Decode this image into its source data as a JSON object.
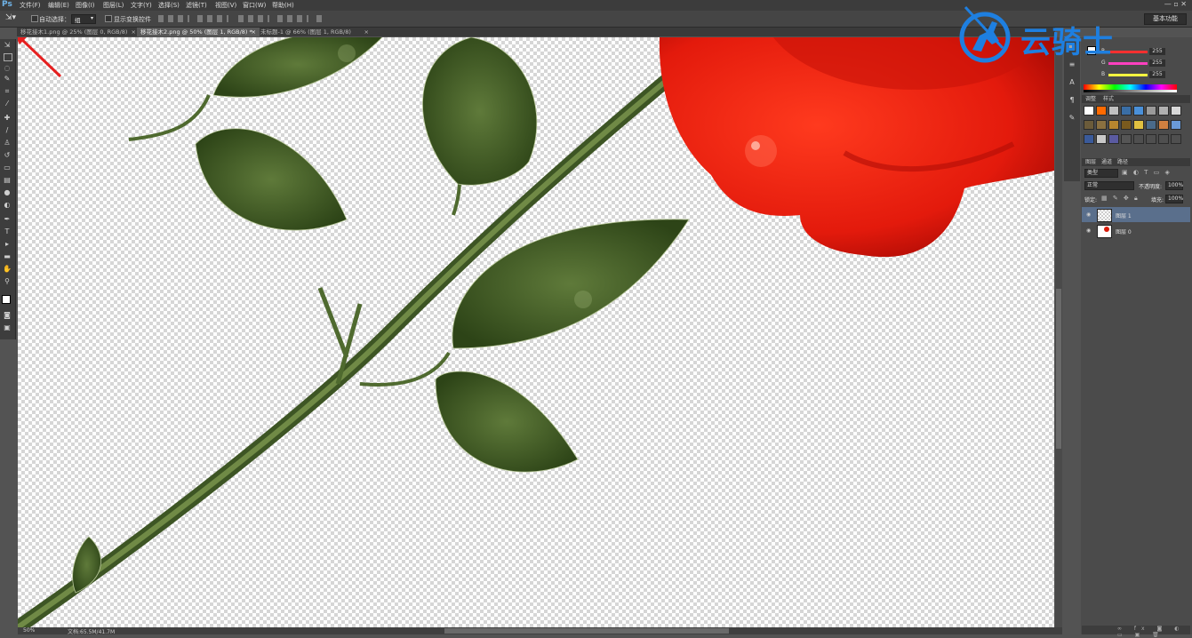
{
  "app": {
    "logo": "Ps"
  },
  "menu": [
    "文件(F)",
    "编辑(E)",
    "图像(I)",
    "图层(L)",
    "文字(Y)",
    "选择(S)",
    "滤镜(T)",
    "视图(V)",
    "窗口(W)",
    "帮助(H)"
  ],
  "window_controls": "— ▫ ✕",
  "options": {
    "auto_select_label": "自动选择：",
    "auto_select_value": "组",
    "show_transform_label": "显示变换控件",
    "workspace": "基本功能"
  },
  "tabs": [
    {
      "label": "移花接木1.png @ 25% (图层 0, RGB/8)",
      "close": "×"
    },
    {
      "label": "移花接木2.png @ 50% (图层 1, RGB/8) *",
      "close": "×"
    },
    {
      "label": "未标题-1 @ 66% (图层 1, RGB/8)",
      "close": "×"
    }
  ],
  "color_panel": {
    "r_label": "R",
    "g_label": "G",
    "b_label": "B",
    "r": "255",
    "g": "255",
    "b": "255",
    "r_color": "#ff3030",
    "g_color": "#ff40c0",
    "b_color": "#ffff40"
  },
  "swatch_tabs": {
    "a": "调整",
    "b": "样式"
  },
  "swatches": [
    "#ffffff",
    "#ff6a00",
    "#c0c0c0",
    "#3a6ea5",
    "#4a90d9",
    "#9a9a9a",
    "#b0b0b0",
    "#d8d8d8",
    "#6b5b3a",
    "#8a7040",
    "#b8862e",
    "#7a5a1e",
    "#e0c040",
    "#4a6a8a",
    "#d08040",
    "#6a9ad8",
    "#3a5a9a",
    "#c8c8c8",
    "#5a5aa0",
    "#555555",
    "#4f4f4f",
    "#4f4f4f",
    "#4f4f4f",
    "#4f4f4f"
  ],
  "layers_panel": {
    "tabs": [
      "图层",
      "通道",
      "路径"
    ],
    "kind": "类型",
    "blend_mode": "正常",
    "opacity_label": "不透明度:",
    "opacity": "100%",
    "lock_label": "锁定:",
    "fill_label": "填充:",
    "fill": "100%",
    "layers": [
      {
        "name": "图层 1",
        "selected": true
      },
      {
        "name": "图层 0",
        "selected": false
      }
    ]
  },
  "status": {
    "zoom": "50%",
    "doc": "文档:65.5M/41.7M"
  },
  "watermark": {
    "text": "云骑士"
  }
}
